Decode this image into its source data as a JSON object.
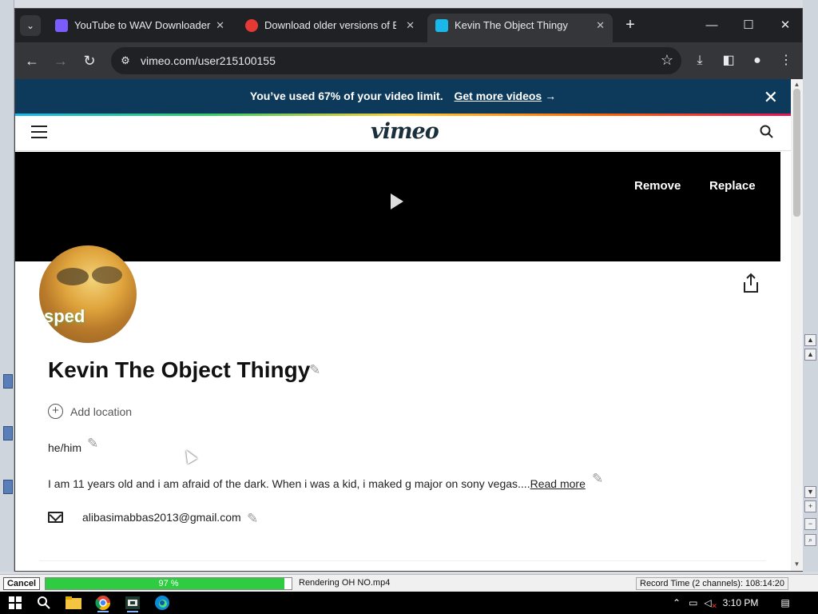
{
  "browser": {
    "tabs": [
      {
        "label": "YouTube to WAV Downloader",
        "favicon_color": "#7b5cff",
        "active": false
      },
      {
        "label": "Download older versions of Bar",
        "favicon_color": "#e53935",
        "active": false
      },
      {
        "label": "Kevin The Object Thingy",
        "favicon_color": "#1ab7ea",
        "active": true
      }
    ],
    "url": "vimeo.com/user215100155"
  },
  "banner": {
    "message": "You’ve used 67% of your video limit.",
    "link": "Get more videos",
    "arrow": "→",
    "bg_color": "#0d3a5a"
  },
  "header": {
    "logo": "vimeo"
  },
  "cover": {
    "remove_label": "Remove",
    "replace_label": "Replace"
  },
  "profile": {
    "avatar_text": "sped",
    "name": "Kevin The Object Thingy",
    "add_location": "Add location",
    "pronouns": "he/him",
    "bio": "I am 11 years old and i am afraid of the dark. When i was a kid, i maked g major on sony vegas....",
    "read_more": "Read more",
    "email": "alibasimabbas2013@gmail.com"
  },
  "vegas": {
    "cancel_label": "Cancel",
    "progress_percent": 97,
    "progress_text": "97 %",
    "render_status": "Rendering OH NO.mp4",
    "record_time": "Record Time (2 channels): 108:14:20"
  },
  "taskbar": {
    "time": "3:10 PM"
  }
}
